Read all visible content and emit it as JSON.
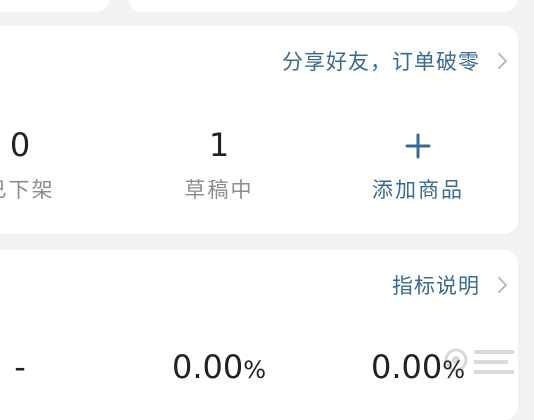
{
  "goods_card": {
    "share_link": "分享好友，订单破零",
    "stats": [
      {
        "value": "0",
        "label": "已下架"
      },
      {
        "value": "1",
        "label": "草稿中"
      }
    ],
    "add_button_label": "添加商品"
  },
  "metrics_card": {
    "link": "指标说明",
    "values": [
      {
        "value": "-",
        "unit": ""
      },
      {
        "value": "0.00",
        "unit": "%"
      },
      {
        "value": "0.00",
        "unit": "%"
      }
    ]
  },
  "colors": {
    "accent": "#3a6a92",
    "muted": "#8c8c8c",
    "card": "#ffffff",
    "background": "#f2f2f2"
  },
  "icons": [
    "chevron-right-icon",
    "plus-icon"
  ]
}
